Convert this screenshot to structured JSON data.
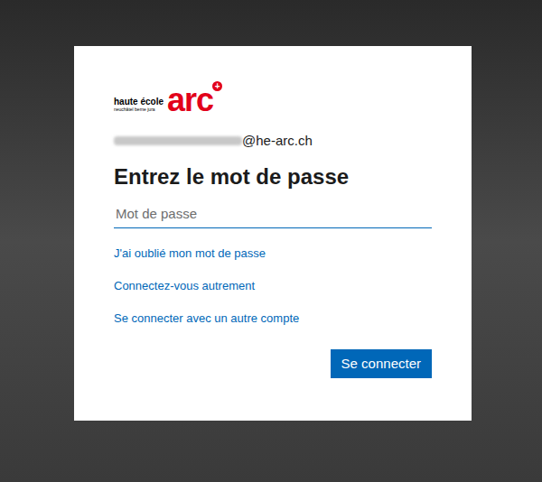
{
  "logo": {
    "line1": "haute école",
    "line2": "neuchâtel berne jura",
    "mark": "arc",
    "badge": "+"
  },
  "account": {
    "masked": true,
    "domain": "@he-arc.ch"
  },
  "heading": "Entrez le mot de passe",
  "password": {
    "placeholder": "Mot de passe",
    "value": ""
  },
  "links": [
    "J'ai oublié mon mot de passe",
    "Connectez-vous autrement",
    "Se connecter avec un autre compte"
  ],
  "buttons": [
    "Se connecter"
  ]
}
